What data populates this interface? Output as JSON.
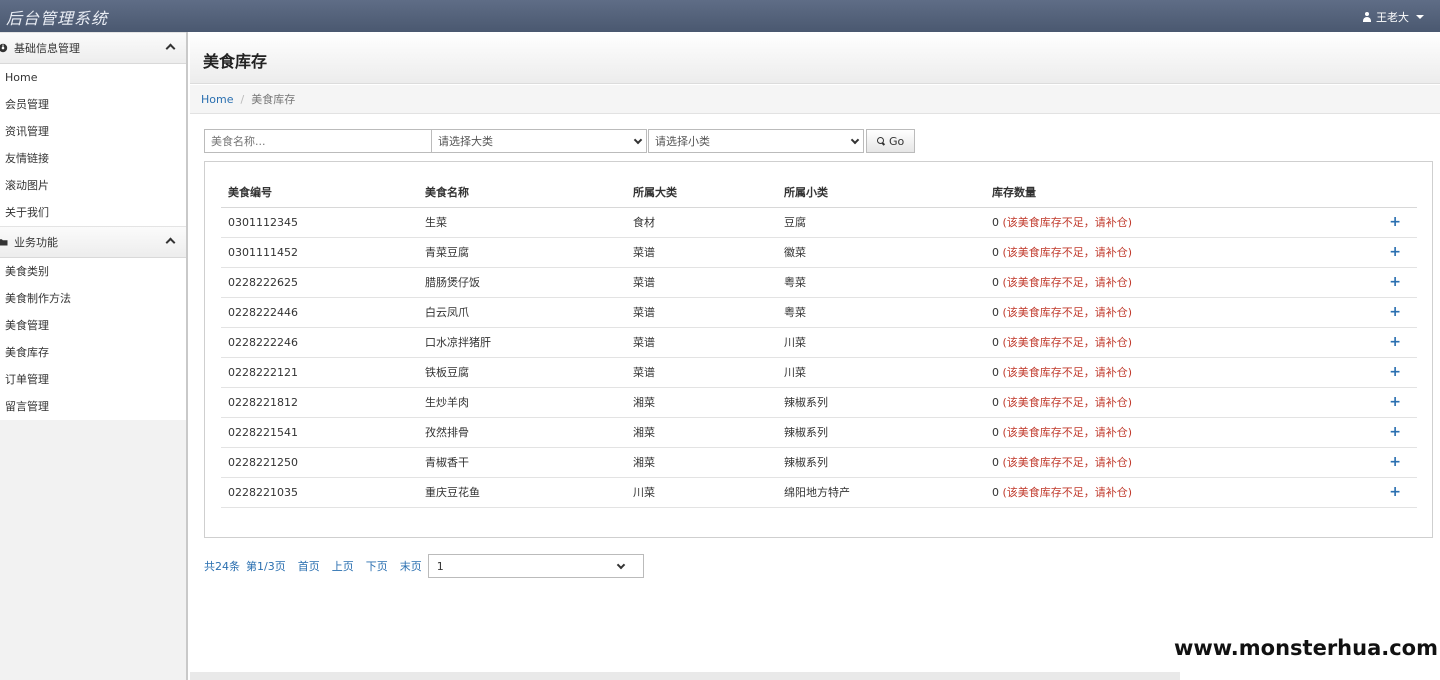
{
  "app": {
    "title": "后台管理系统",
    "user_name": "王老大"
  },
  "sidebar": {
    "groups": [
      {
        "title": "基础信息管理",
        "items": [
          "Home",
          "会员管理",
          "资讯管理",
          "友情链接",
          "滚动图片",
          "关于我们"
        ]
      },
      {
        "title": "业务功能",
        "items": [
          "美食类别",
          "美食制作方法",
          "美食管理",
          "美食库存",
          "订单管理",
          "留言管理"
        ]
      }
    ]
  },
  "page": {
    "title": "美食库存",
    "breadcrumb": {
      "home": "Home",
      "current": "美食库存"
    }
  },
  "filters": {
    "name_placeholder": "美食名称...",
    "category": "请选择大类",
    "subcategory": "请选择小类",
    "go_label": "Go"
  },
  "table": {
    "columns": [
      "美食编号",
      "美食名称",
      "所属大类",
      "所属小类",
      "库存数量"
    ],
    "rows": [
      {
        "id": "0301112345",
        "name": "生菜",
        "category": "食材",
        "subcategory": "豆腐",
        "stock": "0",
        "note": "(该美食库存不足，请补仓)"
      },
      {
        "id": "0301111452",
        "name": "青菜豆腐",
        "category": "菜谱",
        "subcategory": "徽菜",
        "stock": "0",
        "note": "(该美食库存不足，请补仓)"
      },
      {
        "id": "0228222625",
        "name": "腊肠煲仔饭",
        "category": "菜谱",
        "subcategory": "粤菜",
        "stock": "0",
        "note": "(该美食库存不足，请补仓)"
      },
      {
        "id": "0228222446",
        "name": "白云凤爪",
        "category": "菜谱",
        "subcategory": "粤菜",
        "stock": "0",
        "note": "(该美食库存不足，请补仓)"
      },
      {
        "id": "0228222246",
        "name": "口水凉拌猪肝",
        "category": "菜谱",
        "subcategory": "川菜",
        "stock": "0",
        "note": "(该美食库存不足，请补仓)"
      },
      {
        "id": "0228222121",
        "name": "铁板豆腐",
        "category": "菜谱",
        "subcategory": "川菜",
        "stock": "0",
        "note": "(该美食库存不足，请补仓)"
      },
      {
        "id": "0228221812",
        "name": "生炒羊肉",
        "category": "湘菜",
        "subcategory": "辣椒系列",
        "stock": "0",
        "note": "(该美食库存不足，请补仓)"
      },
      {
        "id": "0228221541",
        "name": "孜然排骨",
        "category": "湘菜",
        "subcategory": "辣椒系列",
        "stock": "0",
        "note": "(该美食库存不足，请补仓)"
      },
      {
        "id": "0228221250",
        "name": "青椒香干",
        "category": "湘菜",
        "subcategory": "辣椒系列",
        "stock": "0",
        "note": "(该美食库存不足，请补仓)"
      },
      {
        "id": "0228221035",
        "name": "重庆豆花鱼",
        "category": "川菜",
        "subcategory": "绵阳地方特产",
        "stock": "0",
        "note": "(该美食库存不足，请补仓)"
      }
    ],
    "action_glyph": "+"
  },
  "pager": {
    "total": "共24条",
    "page_info": "第1/3页",
    "first": "首页",
    "prev": "上页",
    "next": "下页",
    "last": "末页",
    "selected_page": "1"
  },
  "watermark": "www.monsterhua.com"
}
